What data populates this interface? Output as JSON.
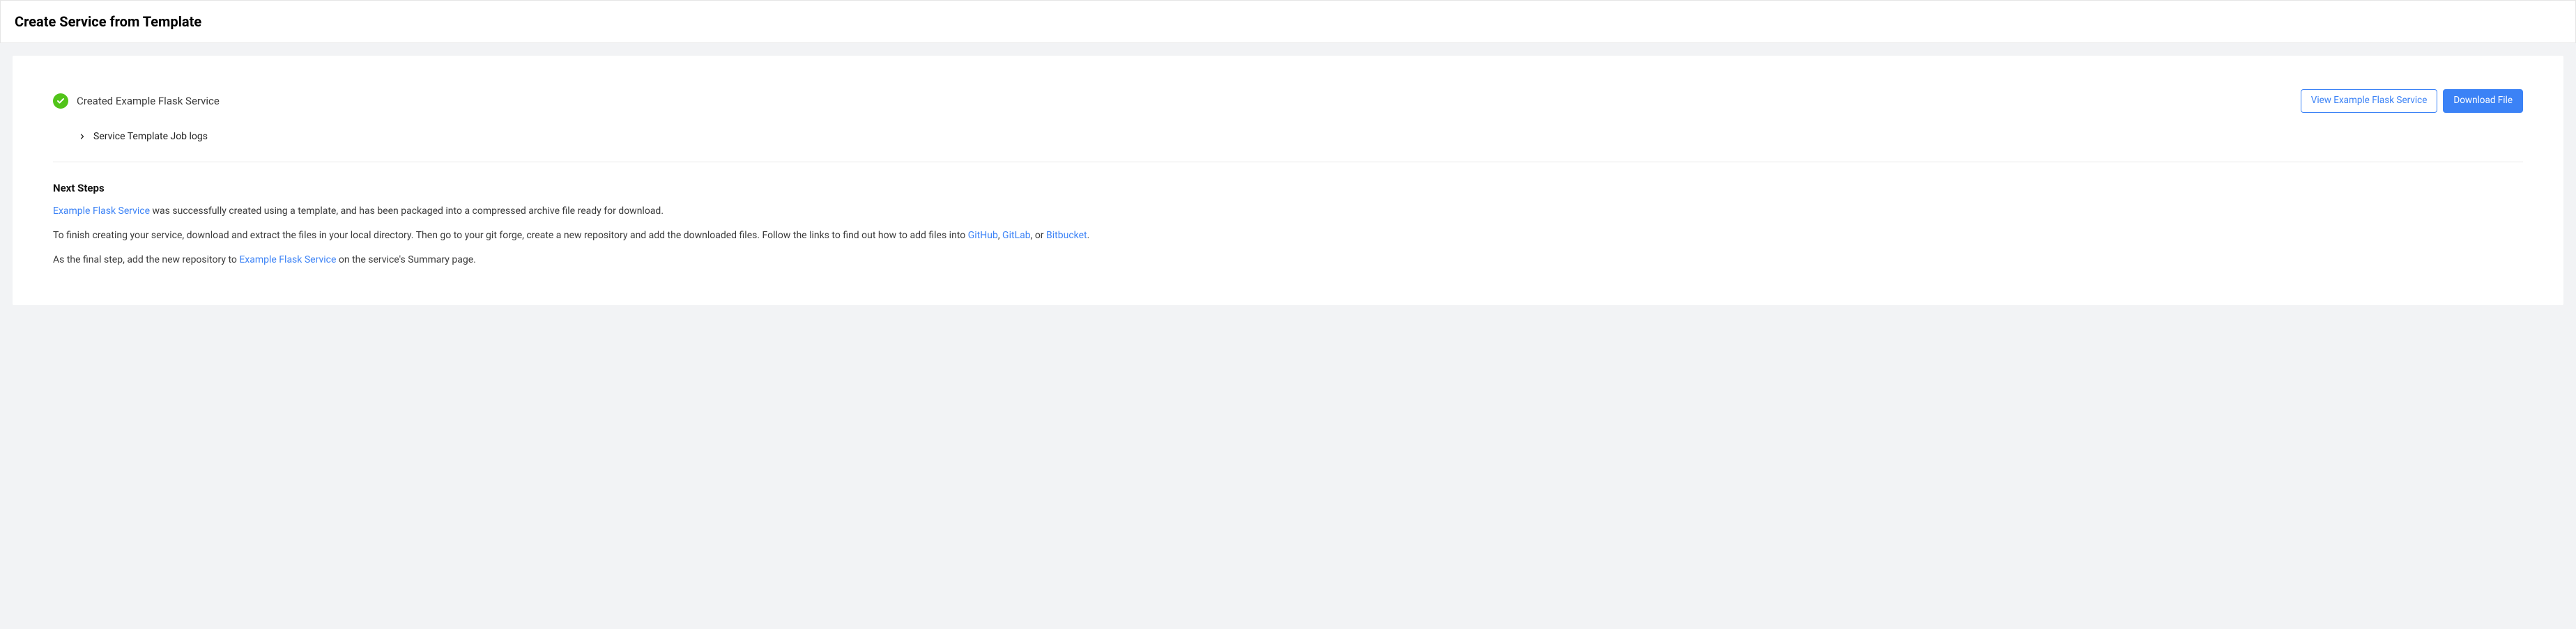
{
  "header": {
    "title": "Create Service from Template"
  },
  "status": {
    "message": "Created Example Flask Service"
  },
  "actions": {
    "view_label": "View Example Flask Service",
    "download_label": "Download File"
  },
  "logs": {
    "label": "Service Template Job logs"
  },
  "next_steps": {
    "heading": "Next Steps",
    "p1": {
      "link": "Example Flask Service",
      "rest": " was successfully created using a template, and has been packaged into a compressed archive file ready for download."
    },
    "p2": {
      "part1": "To finish creating your service, download and extract the files in your local directory. Then go to your git forge, create a new repository and add the downloaded files. Follow the links to find out how to add files into ",
      "github": "GitHub",
      "sep1": ", ",
      "gitlab": "GitLab",
      "sep2": ", or ",
      "bitbucket": "Bitbucket",
      "end": "."
    },
    "p3": {
      "part1": "As the final step, add the new repository to ",
      "link": "Example Flask Service",
      "part2": " on the service's Summary page."
    }
  }
}
